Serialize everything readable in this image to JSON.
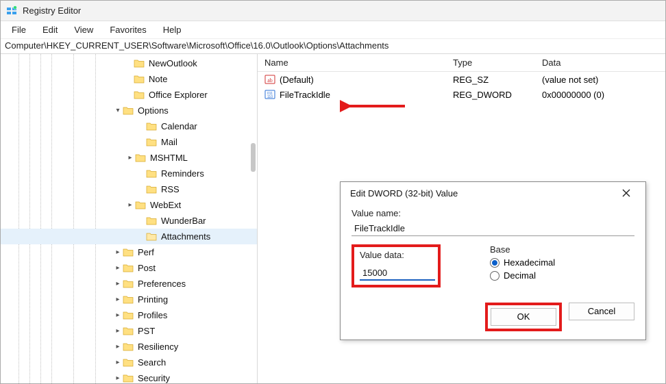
{
  "window": {
    "title": "Registry Editor"
  },
  "menu": {
    "file": "File",
    "edit": "Edit",
    "view": "View",
    "favorites": "Favorites",
    "help": "Help"
  },
  "address": "Computer\\HKEY_CURRENT_USER\\Software\\Microsoft\\Office\\16.0\\Outlook\\Options\\Attachments",
  "tree": [
    {
      "indent": 180,
      "exp": "",
      "label": "NewOutlook"
    },
    {
      "indent": 180,
      "exp": "",
      "label": "Note"
    },
    {
      "indent": 180,
      "exp": "",
      "label": "Office Explorer"
    },
    {
      "indent": 164,
      "exp": "v",
      "label": "Options"
    },
    {
      "indent": 198,
      "exp": "",
      "label": "Calendar"
    },
    {
      "indent": 198,
      "exp": "",
      "label": "Mail"
    },
    {
      "indent": 182,
      "exp": ">",
      "label": "MSHTML"
    },
    {
      "indent": 198,
      "exp": "",
      "label": "Reminders"
    },
    {
      "indent": 198,
      "exp": "",
      "label": "RSS"
    },
    {
      "indent": 182,
      "exp": ">",
      "label": "WebExt"
    },
    {
      "indent": 198,
      "exp": "",
      "label": "WunderBar"
    },
    {
      "indent": 198,
      "exp": "",
      "label": "Attachments",
      "selected": true
    },
    {
      "indent": 164,
      "exp": ">",
      "label": "Perf"
    },
    {
      "indent": 164,
      "exp": ">",
      "label": "Post"
    },
    {
      "indent": 164,
      "exp": ">",
      "label": "Preferences"
    },
    {
      "indent": 164,
      "exp": ">",
      "label": "Printing"
    },
    {
      "indent": 164,
      "exp": ">",
      "label": "Profiles"
    },
    {
      "indent": 164,
      "exp": ">",
      "label": "PST"
    },
    {
      "indent": 164,
      "exp": ">",
      "label": "Resiliency"
    },
    {
      "indent": 164,
      "exp": ">",
      "label": "Search"
    },
    {
      "indent": 164,
      "exp": ">",
      "label": "Security"
    }
  ],
  "columns": {
    "name": "Name",
    "type": "Type",
    "data": "Data"
  },
  "rows": [
    {
      "icon": "string",
      "name": "(Default)",
      "type": "REG_SZ",
      "data": "(value not set)"
    },
    {
      "icon": "binary",
      "name": "FileTrackIdle",
      "type": "REG_DWORD",
      "data": "0x00000000 (0)"
    }
  ],
  "dialog": {
    "title": "Edit DWORD (32-bit) Value",
    "valueNameLabel": "Value name:",
    "valueName": "FileTrackIdle",
    "valueDataLabel": "Value data:",
    "valueData": "15000",
    "baseLabel": "Base",
    "hex": "Hexadecimal",
    "dec": "Decimal",
    "baseSelected": "hex",
    "ok": "OK",
    "cancel": "Cancel"
  }
}
